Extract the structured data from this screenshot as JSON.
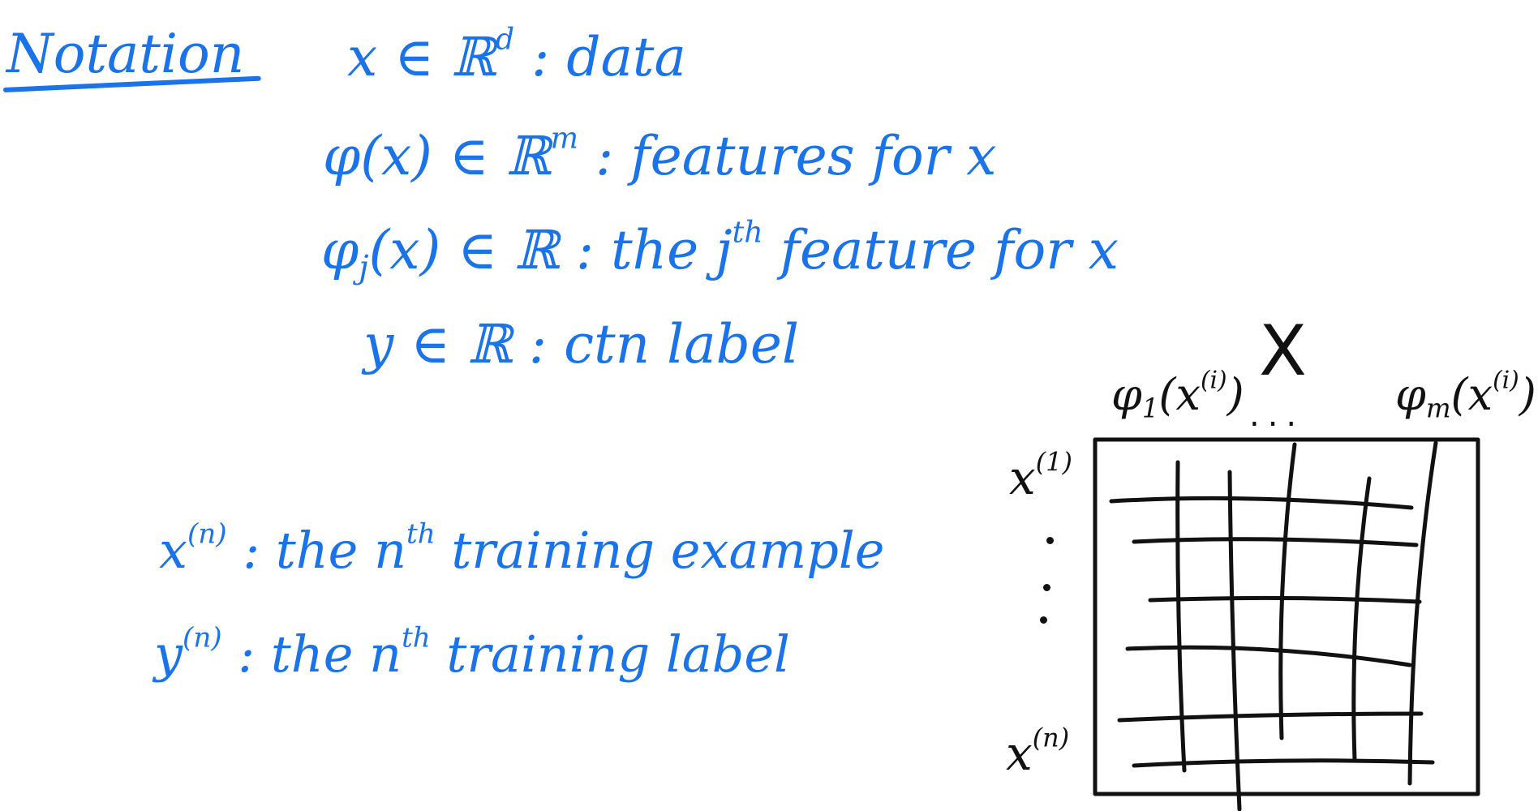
{
  "notes": {
    "title": "Notation",
    "lines": [
      {
        "symbol": "x ∈ ℝ",
        "sup": "d",
        "text": " : data"
      },
      {
        "symbol": "φ(x) ∈ ℝ",
        "sup": "m",
        "text": " : features for x"
      },
      {
        "symbol": "φ",
        "sub": "j",
        "symbol2": "(x) ∈ ℝ",
        "text": " :  the j",
        "sup": "th",
        "text2": " feature for x"
      },
      {
        "symbol": "y ∈ ℝ",
        "text": " : ctn label"
      },
      {
        "symbol": "x",
        "sup": "(n)",
        "text": " : the n",
        "sup2": "th",
        "text2": " training example"
      },
      {
        "symbol": "y",
        "sup": "(n)",
        "text": " : the n",
        "sup2": "th",
        "text2": " training label"
      }
    ]
  },
  "matrix": {
    "label": "X",
    "col_first": {
      "base": "φ",
      "sub": "1",
      "arg": "(x",
      "sup": "(i)",
      "close": ")"
    },
    "col_dots": "...",
    "col_last": {
      "base": "φ",
      "sub": "m",
      "arg": "(x",
      "sup": "(i)",
      "close": ")"
    },
    "row_first": {
      "base": "x",
      "sup": "(1)"
    },
    "row_last": {
      "base": "x",
      "sup": "(n)"
    }
  },
  "colors": {
    "ink_blue": "#1a73e8",
    "ink_black": "#111111"
  }
}
